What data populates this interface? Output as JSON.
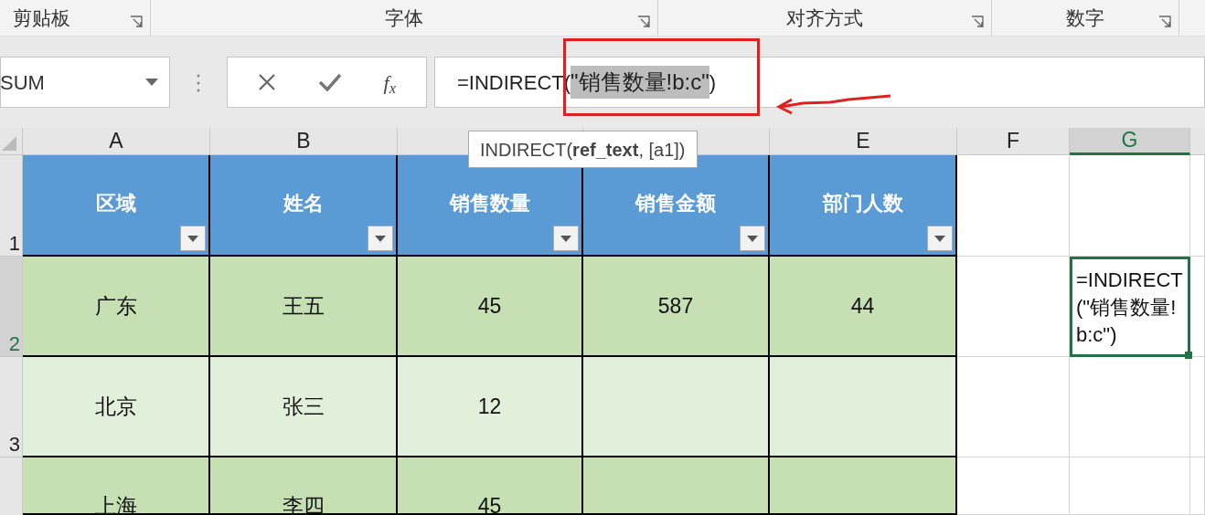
{
  "ribbon_groups": [
    {
      "label": "剪贴板"
    },
    {
      "label": "字体"
    },
    {
      "label": "对齐方式"
    },
    {
      "label": "数字"
    }
  ],
  "name_box": {
    "value": "SUM"
  },
  "function_button": "f$_{x}$",
  "formula_bar": {
    "parts": [
      {
        "text": "=INDIRECT(",
        "selected": false
      },
      {
        "text": "\"销售数量!b:c\"",
        "selected": true
      },
      {
        "text": ")",
        "selected": false
      }
    ]
  },
  "tooltip": "INDIRECT(**ref_text**, [a1])",
  "columns": [
    {
      "label": "A",
      "selected": false
    },
    {
      "label": "B",
      "selected": false
    },
    {
      "label": "E",
      "selected": false
    },
    {
      "label": "F",
      "selected": false
    },
    {
      "label": "G",
      "selected": true
    }
  ],
  "row_numbers": [
    {
      "label": "1",
      "selected": false
    },
    {
      "label": "2",
      "selected": true
    },
    {
      "label": "3",
      "selected": false
    }
  ],
  "table": {
    "headers": [
      "区域",
      "姓名",
      "销售数量",
      "销售金额",
      "部门人数"
    ],
    "rows": [
      [
        "广东",
        "王五",
        "45",
        "587",
        "44"
      ],
      [
        "北京",
        "张三",
        "12",
        null,
        null
      ],
      [
        "上海",
        "李四",
        "45",
        null,
        null
      ]
    ]
  },
  "active_cell": {
    "value": "=INDIRECT(\"销售数量!b:c\")"
  }
}
